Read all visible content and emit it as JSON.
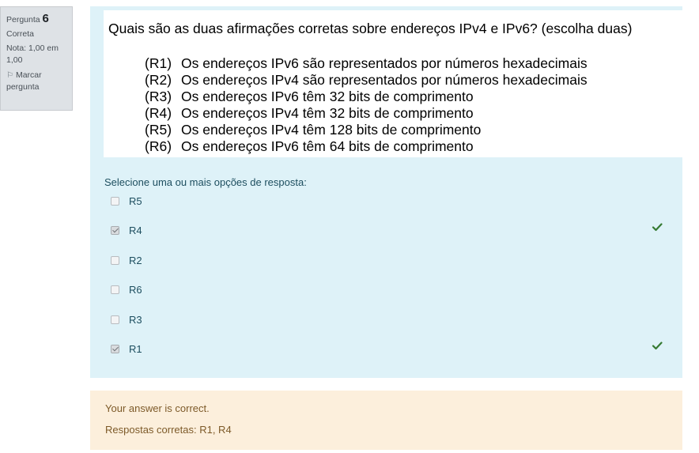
{
  "info": {
    "question_label": "Pergunta",
    "question_number": "6",
    "state": "Correta",
    "grade": "Nota: 1,00 em 1,00",
    "flag_label": "Marcar pergunta"
  },
  "question": {
    "title": "Quais são as duas afirmações corretas sobre endereços IPv4 e IPv6? (escolha duas)",
    "statements": [
      {
        "code": "(R1)",
        "text": "Os endereços IPv6 são representados por números hexadecimais"
      },
      {
        "code": "(R2)",
        "text": "Os endereços IPv4 são representados por números hexadecimais"
      },
      {
        "code": "(R3)",
        "text": "Os endereços IPv6 têm 32 bits de comprimento"
      },
      {
        "code": "(R4)",
        "text": "Os endereços IPv4 têm 32 bits de comprimento"
      },
      {
        "code": "(R5)",
        "text": "Os endereços IPv4 têm 128 bits de comprimento"
      },
      {
        "code": "(R6)",
        "text": "Os endereços IPv6 têm 64 bits de comprimento"
      }
    ],
    "prompt": "Selecione uma ou mais opções de resposta:",
    "options": [
      {
        "label": "R5",
        "checked": false,
        "correct": false
      },
      {
        "label": "R4",
        "checked": true,
        "correct": true
      },
      {
        "label": "R2",
        "checked": false,
        "correct": false
      },
      {
        "label": "R6",
        "checked": false,
        "correct": false
      },
      {
        "label": "R3",
        "checked": false,
        "correct": false
      },
      {
        "label": "R1",
        "checked": true,
        "correct": true
      }
    ]
  },
  "feedback": {
    "message": "Your answer is correct.",
    "right_answer": "Respostas corretas: R1, R4"
  },
  "colors": {
    "formulation_bg": "#def2f8",
    "feedback_bg": "#fcefdc",
    "tick_green": "#357a32"
  }
}
